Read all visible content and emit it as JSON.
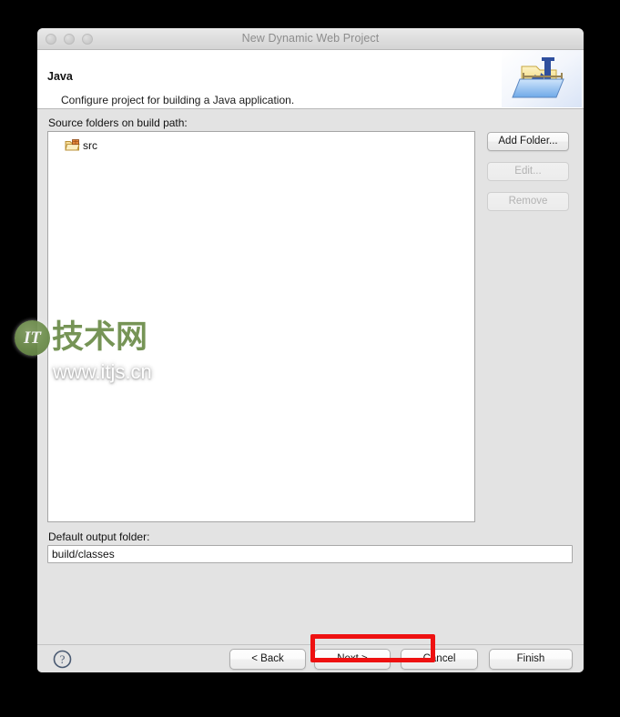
{
  "window": {
    "title": "New Dynamic Web Project",
    "traffic_lights": [
      "close",
      "minimize",
      "maximize"
    ]
  },
  "banner": {
    "title": "Java",
    "description": "Configure project for building a Java application.",
    "icon": "java-folder-icon"
  },
  "body": {
    "source_folders_label": "Source folders on build path:",
    "source_folders": [
      {
        "name": "src",
        "icon": "source-folder-icon"
      }
    ],
    "side_buttons": [
      {
        "label": "Add Folder...",
        "enabled": true
      },
      {
        "label": "Edit...",
        "enabled": false
      },
      {
        "label": "Remove",
        "enabled": false
      }
    ],
    "output_folder_label": "Default output folder:",
    "output_folder_value": "build/classes",
    "output_folder_placeholder": ""
  },
  "footer": {
    "help_icon": "help-question-icon",
    "buttons": [
      {
        "label": "< Back",
        "enabled": true
      },
      {
        "label": "Next >",
        "enabled": true,
        "highlighted": true
      },
      {
        "label": "Cancel",
        "enabled": true
      },
      {
        "label": "Finish",
        "enabled": true
      }
    ]
  },
  "annotation": {
    "color": "#ee1111",
    "target": "Next >"
  },
  "watermark": {
    "badge_text": "IT",
    "cn_text": "技术网",
    "url_text": "www.itjs.cn",
    "color": "#6f8f4e"
  }
}
